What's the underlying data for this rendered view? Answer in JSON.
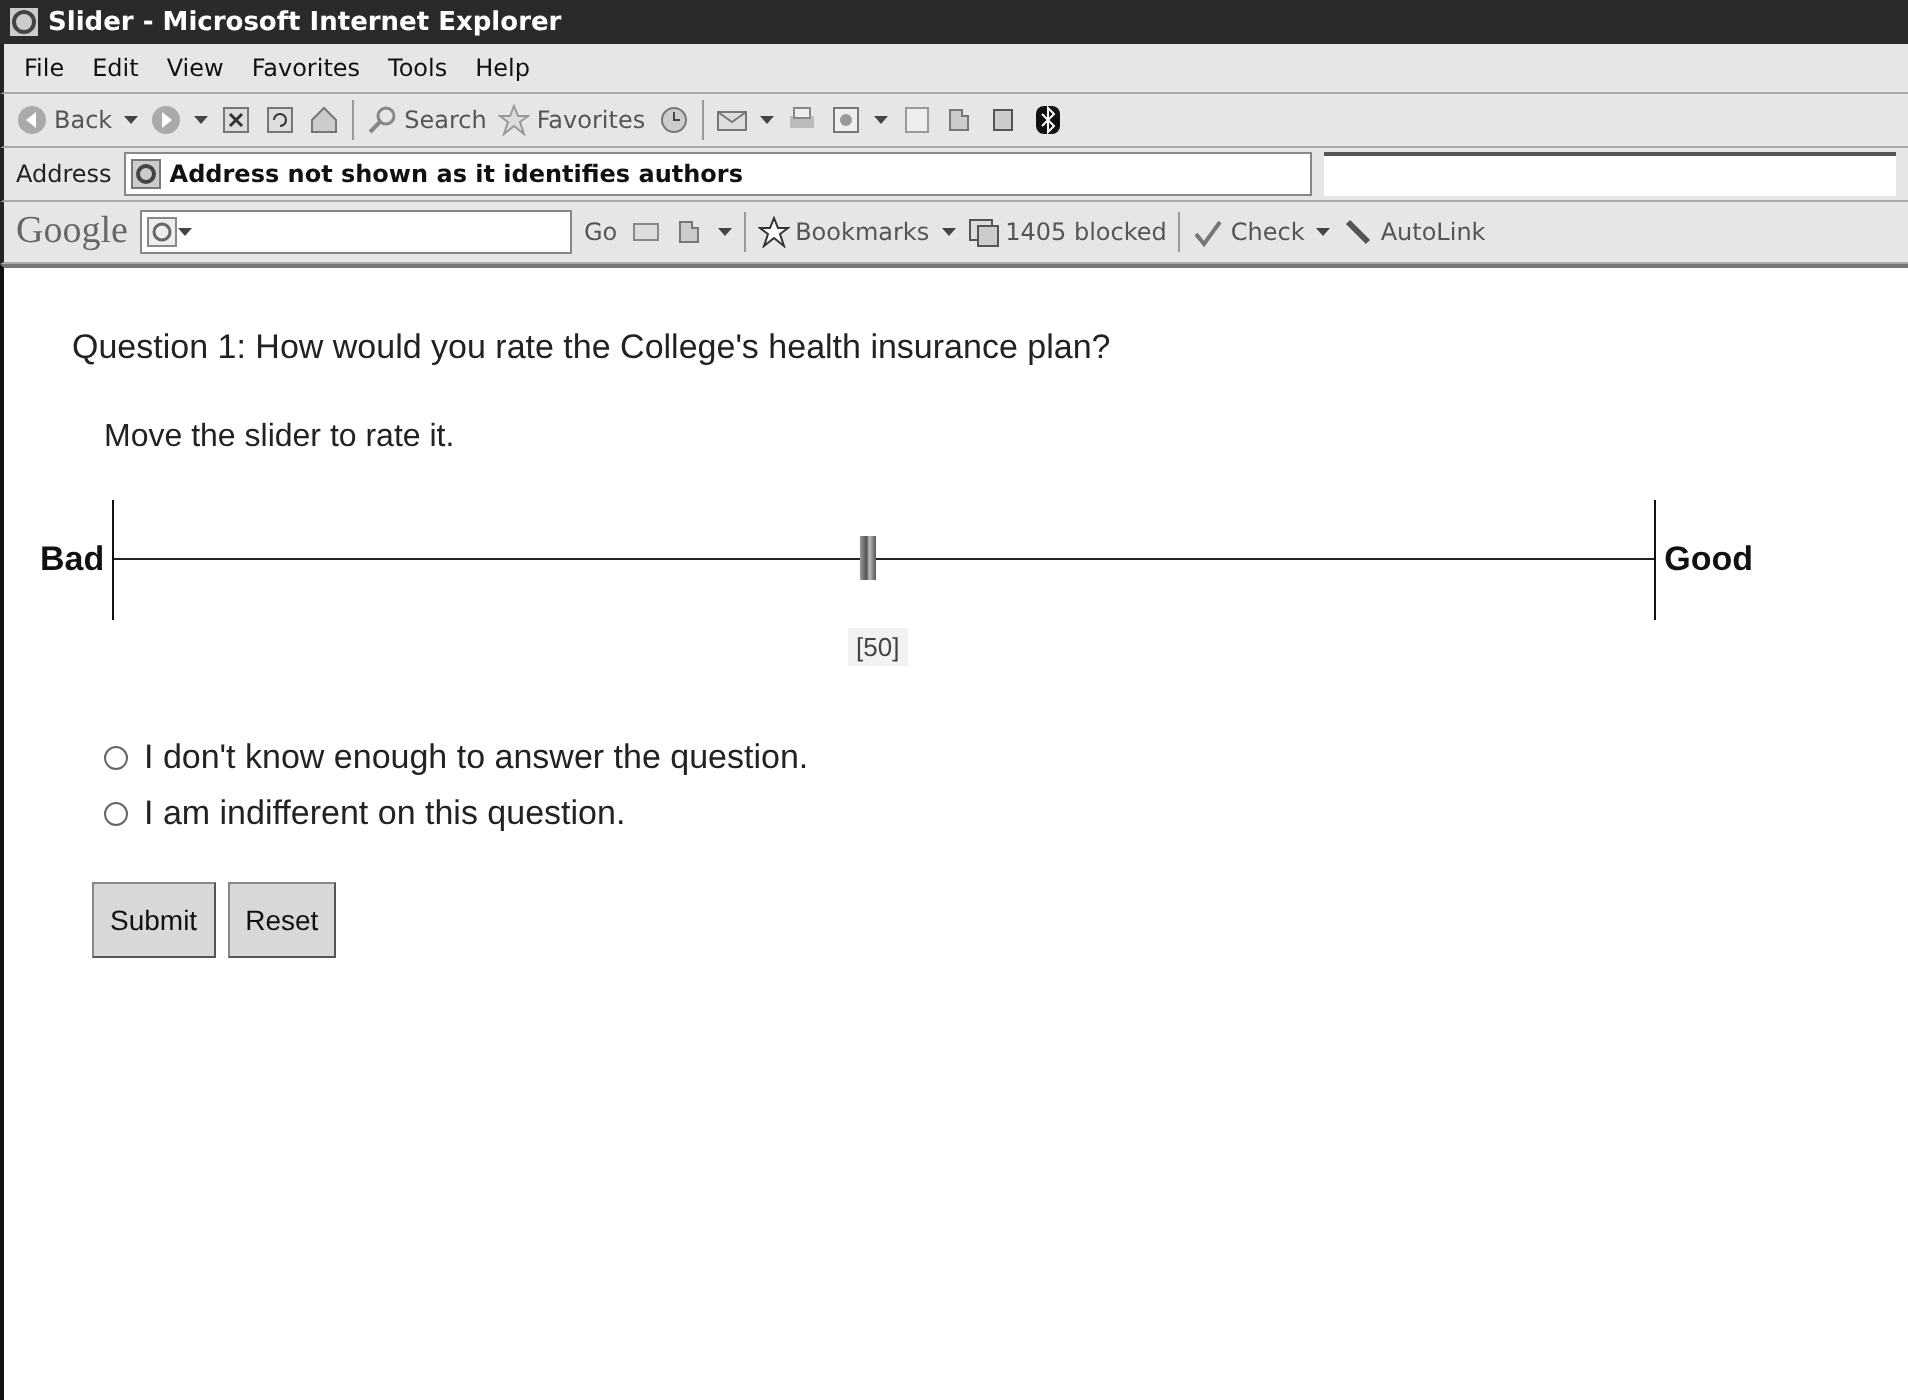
{
  "window": {
    "title": "Slider - Microsoft Internet Explorer"
  },
  "menu": [
    "File",
    "Edit",
    "View",
    "Favorites",
    "Tools",
    "Help"
  ],
  "toolbar": {
    "back": "Back",
    "search": "Search",
    "favorites": "Favorites"
  },
  "address": {
    "label": "Address",
    "value": "Address not shown as it identifies authors"
  },
  "google_bar": {
    "logo": "Google",
    "go": "Go",
    "bookmarks": "Bookmarks",
    "blocked": "1405 blocked",
    "check": "Check",
    "autolink": "AutoLink"
  },
  "question": "Question 1: How would you rate the College's health insurance plan?",
  "instruction": "Move the slider to rate it.",
  "slider": {
    "left_label": "Bad",
    "right_label": "Good",
    "level": 0.49,
    "reading": "[50]"
  },
  "options": [
    {
      "label": "I don't know enough to answer the question.",
      "selected": false
    },
    {
      "label": "I am indifferent on this question.",
      "selected": false
    }
  ],
  "buttons": [
    "Submit",
    "Reset"
  ]
}
